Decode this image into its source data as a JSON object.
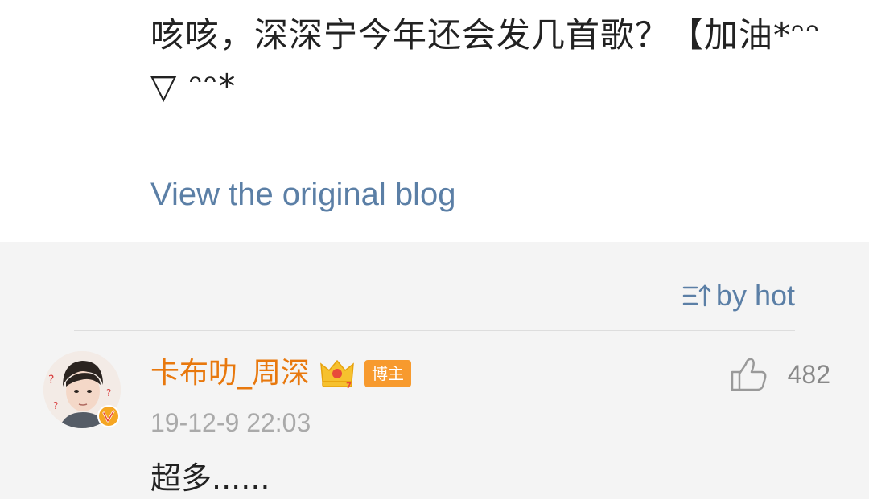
{
  "blog": {
    "text": "咳咳，深深宁今年还会发几首歌？【加油*ᵔᵔ ▽ ᵔᵔ*",
    "view_original": "View the original blog"
  },
  "comments_header": {
    "sort_label": "by hot",
    "sort_icon": "sort-icon"
  },
  "comment": {
    "username": "卡布叻_周深",
    "badge": "博主",
    "timestamp": "19-12-9 22:03",
    "text": "超多......",
    "likes": "482"
  },
  "colors": {
    "link": "#5b7fa6",
    "username": "#e8780d",
    "badge_bg": "#f79a2e",
    "comments_bg": "#f4f4f4"
  }
}
